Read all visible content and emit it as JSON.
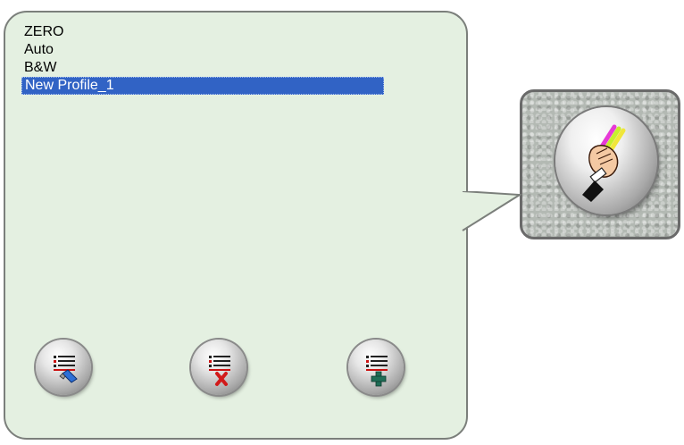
{
  "profiles": {
    "items": [
      {
        "label": "ZERO",
        "selected": false
      },
      {
        "label": "Auto",
        "selected": false
      },
      {
        "label": "B&W",
        "selected": false
      },
      {
        "label": "New Profile_1",
        "selected": true
      }
    ],
    "selected_color": "#3163c5"
  },
  "panel": {
    "background": "#e4f0e1"
  },
  "buttons": {
    "edit_icon": "list-pencil-icon",
    "delete_icon": "list-delete-icon",
    "add_icon": "list-add-icon",
    "main_icon": "hand-marker-icon"
  }
}
